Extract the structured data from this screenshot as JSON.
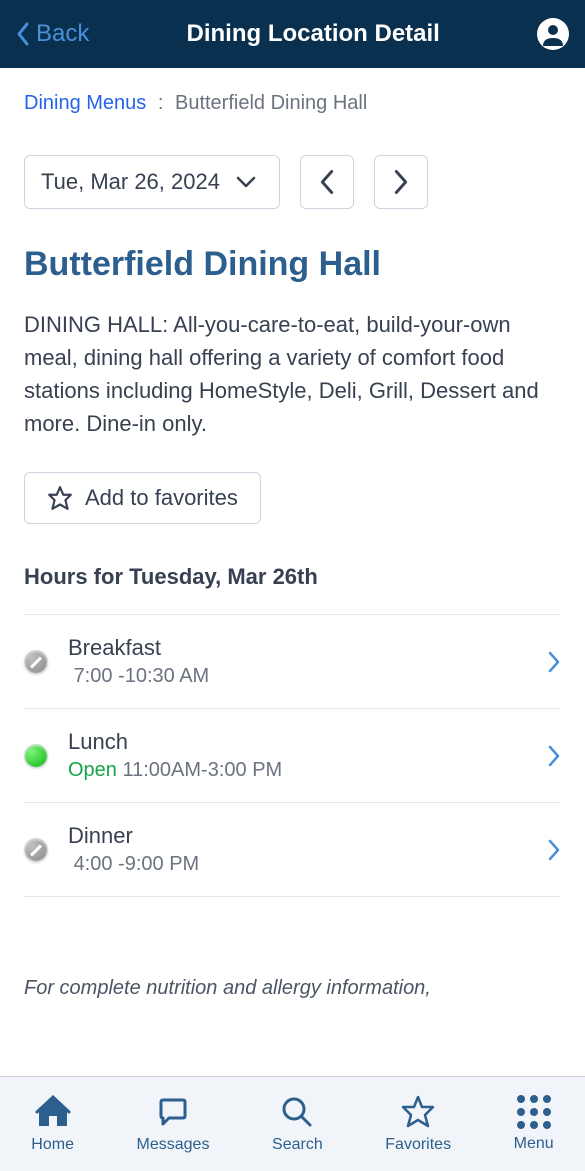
{
  "header": {
    "back_label": "Back",
    "title": "Dining Location Detail"
  },
  "breadcrumb": {
    "link": "Dining Menus",
    "separator": ":",
    "current": "Butterfield Dining Hall"
  },
  "date_picker": {
    "value": "Tue, Mar 26, 2024"
  },
  "hall": {
    "title": "Butterfield Dining Hall",
    "description": "DINING HALL: All-you-care-to-eat, build-your-own meal, dining hall offering a variety of comfort food stations including HomeStyle, Deli, Grill, Dessert and more. Dine-in only."
  },
  "favorite_btn": "Add to favorites",
  "hours": {
    "title": "Hours for Tuesday, Mar 26th",
    "items": [
      {
        "meal": "Breakfast",
        "time": "7:00 -10:30 AM",
        "status": "closed",
        "open_label": ""
      },
      {
        "meal": "Lunch",
        "time": "11:00AM-3:00 PM",
        "status": "open",
        "open_label": "Open "
      },
      {
        "meal": "Dinner",
        "time": "4:00 -9:00 PM",
        "status": "closed",
        "open_label": ""
      }
    ]
  },
  "footer_note": "For complete nutrition and allergy information,",
  "nav": {
    "home": "Home",
    "messages": "Messages",
    "search": "Search",
    "favorites": "Favorites",
    "menu": "Menu"
  }
}
